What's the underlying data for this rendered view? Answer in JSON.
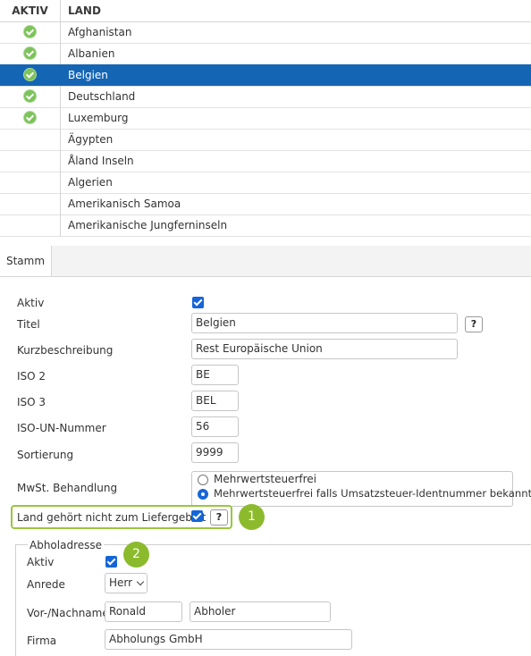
{
  "table": {
    "headers": {
      "aktiv": "AKTIV",
      "land": "LAND"
    },
    "rows": [
      {
        "land": "Afghanistan",
        "aktiv": true,
        "selected": false
      },
      {
        "land": "Albanien",
        "aktiv": true,
        "selected": false
      },
      {
        "land": "Belgien",
        "aktiv": true,
        "selected": true
      },
      {
        "land": "Deutschland",
        "aktiv": true,
        "selected": false
      },
      {
        "land": "Luxemburg",
        "aktiv": true,
        "selected": false
      },
      {
        "land": "Ägypten",
        "aktiv": false,
        "selected": false
      },
      {
        "land": "Åland Inseln",
        "aktiv": false,
        "selected": false
      },
      {
        "land": "Algerien",
        "aktiv": false,
        "selected": false
      },
      {
        "land": "Amerikanisch Samoa",
        "aktiv": false,
        "selected": false
      },
      {
        "land": "Amerikanische Jungferninseln",
        "aktiv": false,
        "selected": false
      }
    ]
  },
  "tabs": {
    "stamm": "Stamm"
  },
  "form": {
    "aktiv_label": "Aktiv",
    "aktiv_checked": true,
    "titel_label": "Titel",
    "titel_value": "Belgien",
    "kurz_label": "Kurzbeschreibung",
    "kurz_value": "Rest Europäische Union",
    "iso2_label": "ISO 2",
    "iso2_value": "BE",
    "iso3_label": "ISO 3",
    "iso3_value": "BEL",
    "isoun_label": "ISO-UN-Nummer",
    "isoun_value": "56",
    "sort_label": "Sortierung",
    "sort_value": "9999",
    "mwst_label": "MwSt. Behandlung",
    "mwst_option1": "Mehrwertsteuerfrei",
    "mwst_option2": "Mehrwertsteuerfrei falls Umsatzsteuer-Identnummer bekannt",
    "mwst_selected": 2,
    "liefer_label": "Land gehört nicht zum Liefergebiet",
    "liefer_checked": true,
    "help_glyph": "?",
    "badge1": "1",
    "badge2": "2"
  },
  "abholadresse": {
    "legend": "Abholadresse",
    "aktiv_label": "Aktiv",
    "aktiv_checked": true,
    "anrede_label": "Anrede",
    "anrede_value": "Herr",
    "name_label": "Vor-/Nachname",
    "vorname_value": "Ronald",
    "nachname_value": "Abholer",
    "firma_label": "Firma",
    "firma_value": "Abholungs GmbH"
  },
  "colors": {
    "accent": "#1565b5",
    "active_icon": "#7dc25c",
    "highlight": "#9ac63f"
  }
}
